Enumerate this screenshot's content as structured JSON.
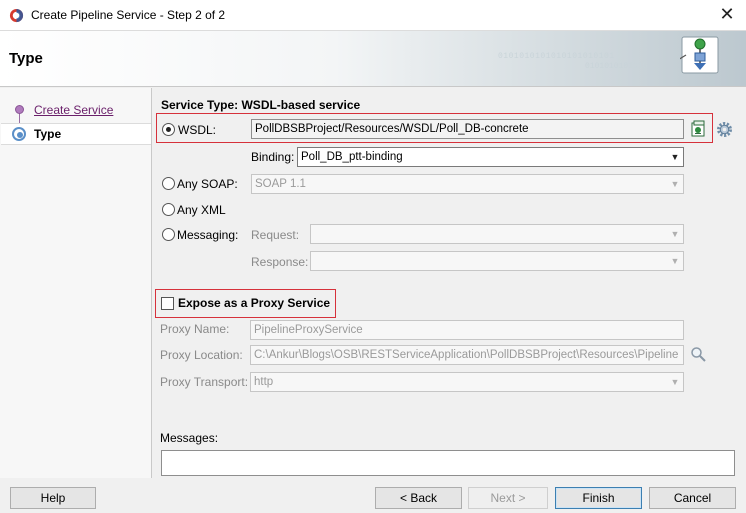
{
  "window": {
    "title": "Create Pipeline Service - Step 2 of 2",
    "close_glyph": "✕"
  },
  "header": {
    "title": "Type",
    "binary_line1": "0101010101010101010101",
    "binary_line2": "0101010101010"
  },
  "nav": {
    "items": [
      {
        "label": "Create Service",
        "state": "visited"
      },
      {
        "label": "Type",
        "state": "current"
      }
    ]
  },
  "service_type": {
    "heading": "Service Type: WSDL-based service",
    "wsdl": {
      "label": "WSDL:",
      "value": "PollDBSBProject/Resources/WSDL/Poll_DB-concrete",
      "selected": true
    },
    "binding": {
      "label": "Binding:",
      "value": "Poll_DB_ptt-binding"
    },
    "any_soap": {
      "label": "Any SOAP:",
      "value": "SOAP 1.1"
    },
    "any_xml": {
      "label": "Any XML"
    },
    "messaging": {
      "label": "Messaging:",
      "request_label": "Request:",
      "response_label": "Response:"
    }
  },
  "proxy": {
    "expose_label": "Expose as a Proxy Service",
    "checked": false,
    "name_label": "Proxy Name:",
    "name_value": "PipelineProxyService",
    "location_label": "Proxy Location:",
    "location_value": "C:\\Ankur\\Blogs\\OSB\\RESTServiceApplication\\PollDBSBProject\\Resources\\Pipeline",
    "transport_label": "Proxy Transport:",
    "transport_value": "http"
  },
  "messages": {
    "label": "Messages:",
    "value": ""
  },
  "buttons": {
    "help": "Help",
    "back": "< Back",
    "next": "Next >",
    "finish": "Finish",
    "cancel": "Cancel"
  },
  "icons": {
    "app": "oracle-logo-icon",
    "wsdl_browse": "wsdl-browse-icon",
    "wsdl_settings": "gear-icon",
    "location_browse": "magnifier-icon"
  }
}
